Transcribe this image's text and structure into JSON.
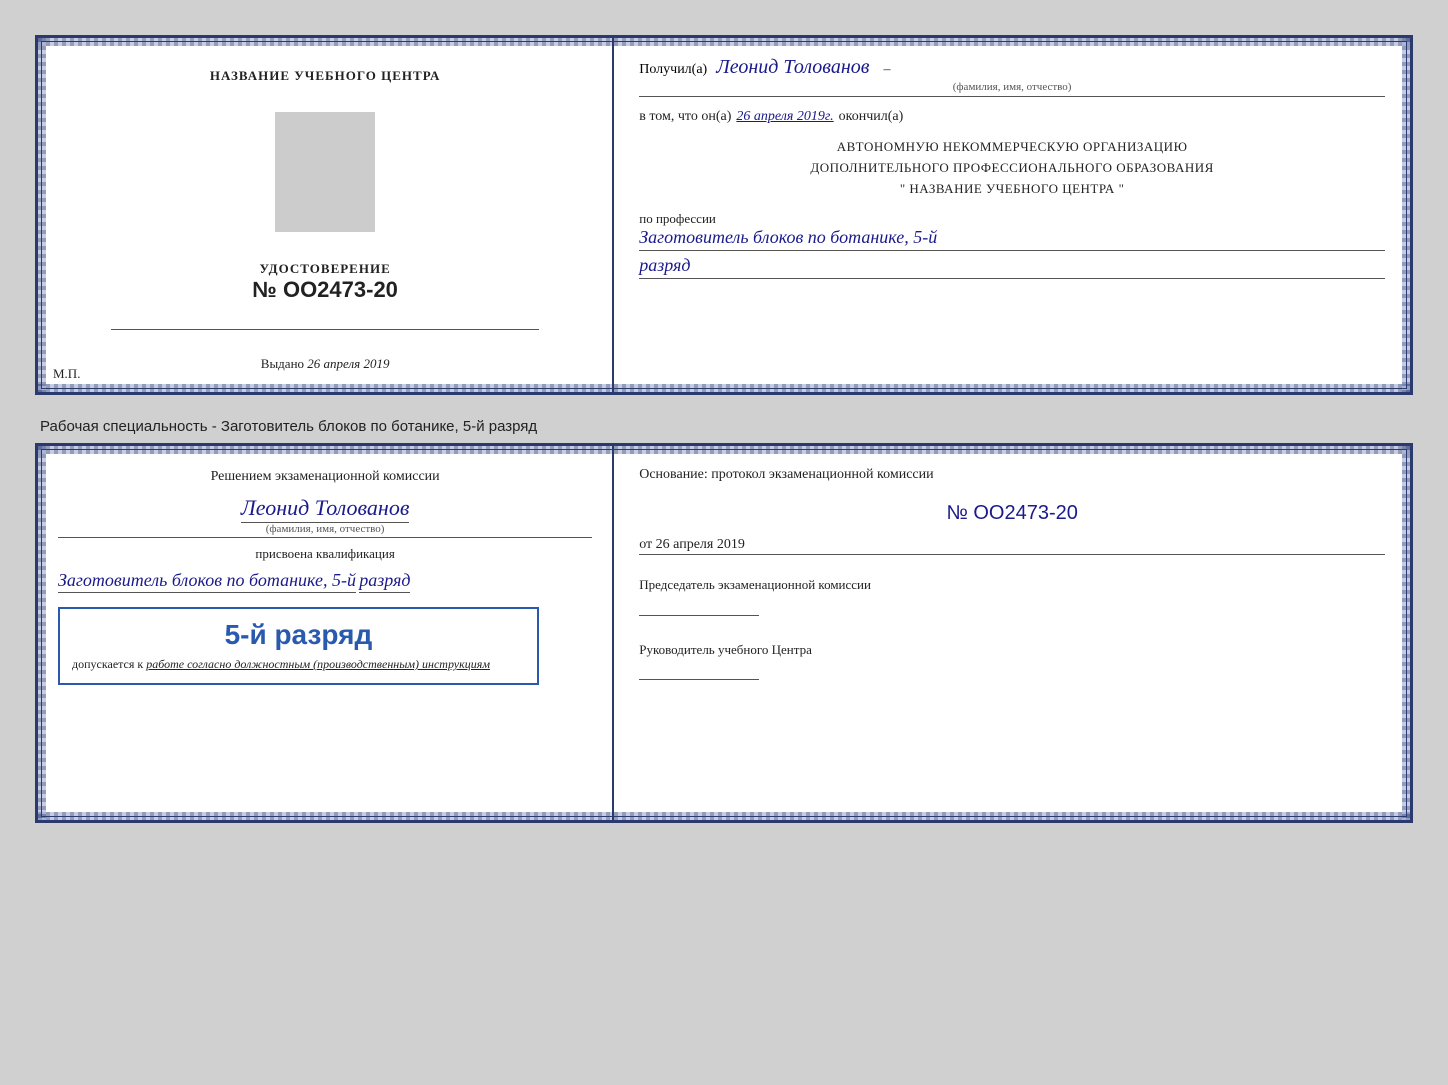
{
  "page": {
    "background_color": "#d0d0d0"
  },
  "top_doc": {
    "left": {
      "training_center_label": "НАЗВАНИЕ УЧЕБНОГО ЦЕНТРА",
      "cert_label": "УДОСТОВЕРЕНИЕ",
      "cert_number_prefix": "№",
      "cert_number": "OO2473-20",
      "issued_label": "Выдано",
      "issued_date": "26 апреля 2019",
      "mp_label": "М.П."
    },
    "right": {
      "received_label": "Получил(а)",
      "recipient_name": "Леонид Толованов",
      "fio_sublabel": "(фамилия, имя, отчество)",
      "body_text": "в том, что он(а)",
      "date_value": "26 апреля 2019г.",
      "finished_label": "окончил(а)",
      "org_line1": "АВТОНОМНУЮ НЕКОММЕРЧЕСКУЮ ОРГАНИЗАЦИЮ",
      "org_line2": "ДОПОЛНИТЕЛЬНОГО ПРОФЕССИОНАЛЬНОГО ОБРАЗОВАНИЯ",
      "org_line3": "\"  НАЗВАНИЕ УЧЕБНОГО ЦЕНТРА  \"",
      "profession_label": "по профессии",
      "profession_value": "Заготовитель блоков по ботанике, 5-й",
      "razryad_value": "разряд"
    }
  },
  "specialty_label": "Рабочая специальность - Заготовитель блоков по ботанике, 5-й разряд",
  "bottom_doc": {
    "left": {
      "decision_text": "Решением экзаменационной комиссии",
      "person_name": "Леонид Толованов",
      "fio_sublabel": "(фамилия, имя, отчество)",
      "assigned_text": "присвоена квалификация",
      "qualification_value": "Заготовитель блоков по ботанике, 5-й",
      "razryad_value": "разряд",
      "stamp_rank": "5-й разряд",
      "stamp_allowed": "допускается к",
      "stamp_italic": "работе согласно должностным (производственным) инструкциям"
    },
    "right": {
      "basis_label": "Основание: протокол экзаменационной комиссии",
      "protocol_prefix": "№",
      "protocol_number": "OO2473-20",
      "date_prefix": "от",
      "date_value": "26 апреля 2019",
      "chairman_label": "Председатель экзаменационной комиссии",
      "head_label": "Руководитель учебного Центра"
    }
  }
}
